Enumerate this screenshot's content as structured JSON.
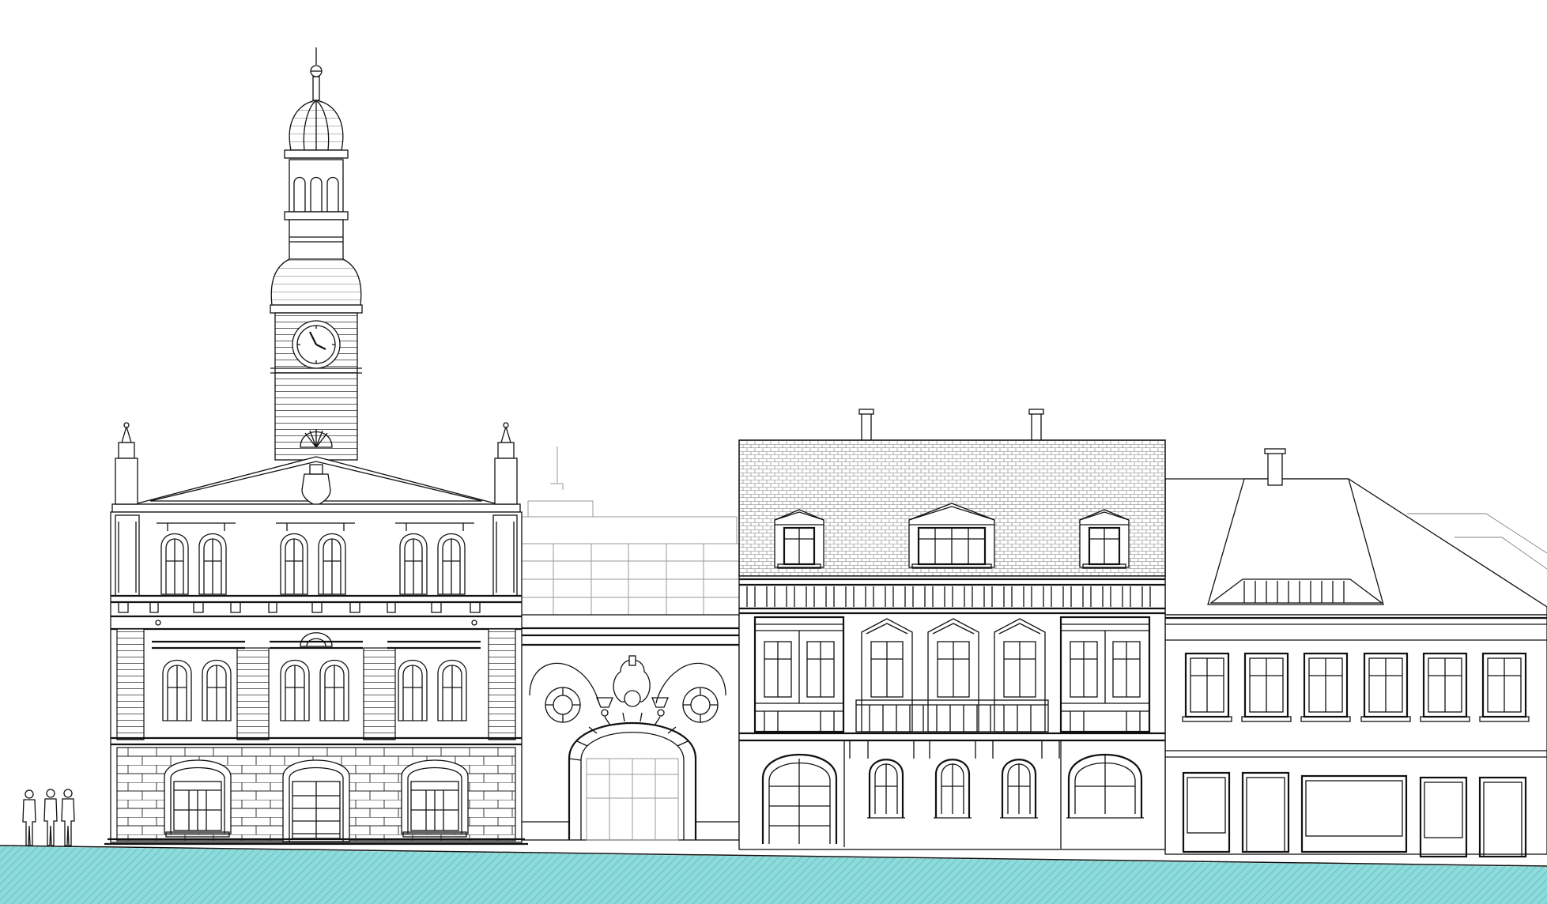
{
  "drawing": {
    "type": "street elevation",
    "buildings": [
      {
        "name": "town-hall-with-clock-tower",
        "features": [
          "clock-tower",
          "pediment",
          "arched-windows",
          "rusticated-ground-floor",
          "three-ground-floor-arches"
        ]
      },
      {
        "name": "glazed-infill-building",
        "features": [
          "glass-curtain-wall",
          "ornate-archway",
          "circular-medallions"
        ]
      },
      {
        "name": "mansard-roof-building",
        "features": [
          "tiled-mansard-roof",
          "three-dormers",
          "two-chimneys",
          "balcony",
          "ground-floor-arched-openings"
        ]
      },
      {
        "name": "hipped-roof-building",
        "features": [
          "hipped-roof",
          "chimney",
          "six-upper-windows",
          "shopfront-openings"
        ]
      }
    ],
    "figures": 3,
    "ground_color": "#8fdada",
    "ground_stripe_color": "#5fc4c4",
    "line_color": "#111111"
  }
}
